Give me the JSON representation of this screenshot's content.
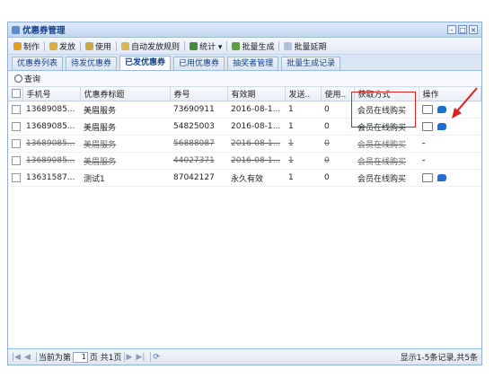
{
  "window": {
    "title": "优惠券管理",
    "controls": [
      "-",
      "□",
      "×"
    ]
  },
  "toolbar": {
    "items": [
      {
        "label": "制作",
        "icon": "edit-icon"
      },
      {
        "label": "发放",
        "icon": "send-icon"
      },
      {
        "label": "使用",
        "icon": "use-icon"
      },
      {
        "label": "自动发放规则",
        "icon": "rule-icon"
      },
      {
        "label": "统计 ▾",
        "icon": "chart-icon"
      },
      {
        "label": "批量生成",
        "icon": "batch-icon"
      },
      {
        "label": "批量延期",
        "icon": "extend-icon"
      }
    ]
  },
  "tabs": [
    "优惠券列表",
    "待发优惠券",
    "已发优惠券",
    "已用优惠券",
    "抽奖者管理",
    "批量生成记录"
  ],
  "active_tab": 2,
  "query": {
    "label": "查询"
  },
  "grid": {
    "headers": [
      "手机号",
      "优惠券标题",
      "券号",
      "有效期",
      "发送..",
      "使用..",
      "获取方式",
      "操作"
    ],
    "rows": [
      {
        "phone": "13689085...",
        "title": "美眉服务",
        "code": "73690911",
        "expiry": "2016-08-1...",
        "sent": "1",
        "used": "0",
        "method": "会员在线购买",
        "ops": true,
        "deleted": false
      },
      {
        "phone": "13689085...",
        "title": "美眉服务",
        "code": "54825003",
        "expiry": "2016-08-1...",
        "sent": "1",
        "used": "0",
        "method": "会员在线购买",
        "ops": true,
        "deleted": false
      },
      {
        "phone": "13689085...",
        "title": "美眉服务",
        "code": "56888087",
        "expiry": "2016-08-1...",
        "sent": "1",
        "used": "0",
        "method": "会员在线购买",
        "ops": false,
        "deleted": true
      },
      {
        "phone": "13689085...",
        "title": "美眉服务",
        "code": "44027371",
        "expiry": "2016-08-1...",
        "sent": "1",
        "used": "0",
        "method": "会员在线购买",
        "ops": false,
        "deleted": true
      },
      {
        "phone": "13631587...",
        "title": "测试1",
        "code": "87042127",
        "expiry": "永久有效",
        "sent": "1",
        "used": "0",
        "method": "会员在线购买",
        "ops": true,
        "deleted": false
      }
    ]
  },
  "pager": {
    "current_label": "当前为第",
    "page": "1",
    "total_label": "页 共1页",
    "summary": "显示1-5条记录,共5条"
  },
  "colors": {
    "accent": "#15428b",
    "highlight": "#e02020",
    "undo": "#1f6fd0"
  }
}
